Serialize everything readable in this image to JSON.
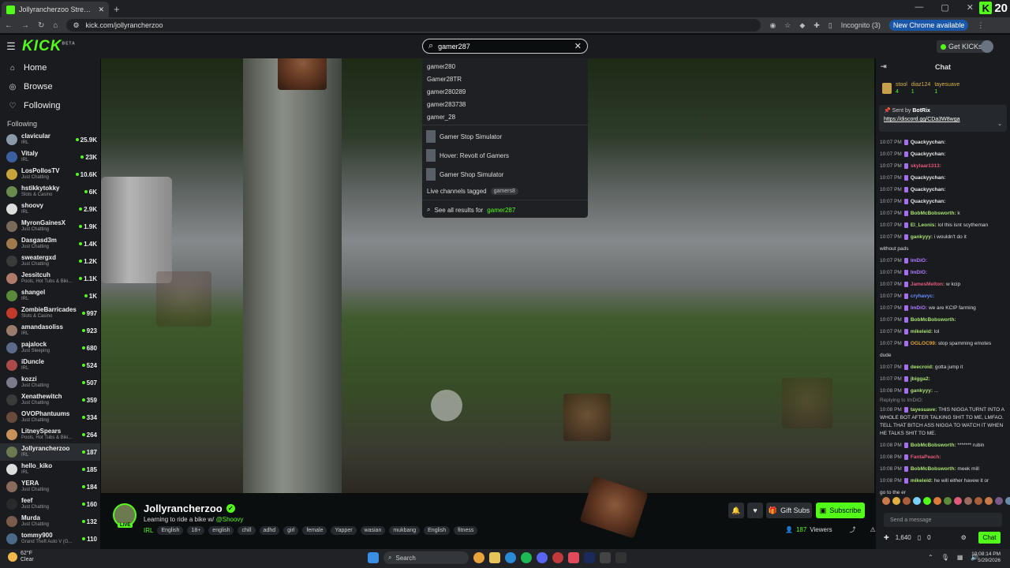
{
  "browser": {
    "tab_title": "Jollyrancherzoo Stream - Watc",
    "new_tab": "+",
    "url": "kick.com/jollyrancherzoo",
    "incognito": "Incognito (3)",
    "new_chrome": "New Chrome available"
  },
  "corner": {
    "logo": "K",
    "num": "20"
  },
  "header": {
    "logo": "KICK",
    "beta": "BETA",
    "search_value": "gamer287",
    "get_kicks": "Get KICKs"
  },
  "nav": [
    {
      "label": "Home",
      "icon": "home-icon"
    },
    {
      "label": "Browse",
      "icon": "compass-icon"
    },
    {
      "label": "Following",
      "icon": "heart-icon"
    }
  ],
  "following_title": "Following",
  "channels": [
    {
      "name": "clavicular",
      "cat": "IRL",
      "viewers": "25.9K",
      "color": "#8a9aa8"
    },
    {
      "name": "Vitaly",
      "cat": "IRL",
      "viewers": "23K",
      "color": "#3b5fa0"
    },
    {
      "name": "LosPollosTV",
      "cat": "Just Chatting",
      "viewers": "10.6K",
      "color": "#c8a23a"
    },
    {
      "name": "hstikkytokky",
      "cat": "Slots & Casino",
      "viewers": "6K",
      "color": "#6b8a4e"
    },
    {
      "name": "shoovy",
      "cat": "IRL",
      "viewers": "2.9K",
      "color": "#ddd"
    },
    {
      "name": "MyronGainesX",
      "cat": "Just Chatting",
      "viewers": "1.9K",
      "color": "#7a6a5a"
    },
    {
      "name": "Dasgasd3m",
      "cat": "Just Chatting",
      "viewers": "1.4K",
      "color": "#a0784e"
    },
    {
      "name": "sweatergxd",
      "cat": "Just Chatting",
      "viewers": "1.2K",
      "color": "#3a3a3a"
    },
    {
      "name": "Jessitcuh",
      "cat": "Pools, Hot Tubs & Biki...",
      "viewers": "1.1K",
      "color": "#b07a6a"
    },
    {
      "name": "shangel",
      "cat": "IRL",
      "viewers": "1K",
      "color": "#5a8a3a"
    },
    {
      "name": "ZombieBarricades",
      "cat": "Slots & Casino",
      "viewers": "997",
      "color": "#c23a2a"
    },
    {
      "name": "amandasoliss",
      "cat": "IRL",
      "viewers": "923",
      "color": "#9a7a6a"
    },
    {
      "name": "pajalock",
      "cat": "Just Sleeping",
      "viewers": "680",
      "color": "#5a6a8a"
    },
    {
      "name": "iDuncle",
      "cat": "IRL",
      "viewers": "524",
      "color": "#aa4a4a"
    },
    {
      "name": "kozzi",
      "cat": "Just Chatting",
      "viewers": "507",
      "color": "#7a7a8a"
    },
    {
      "name": "Xenathewitch",
      "cat": "Just Chatting",
      "viewers": "359",
      "color": "#3a3a3a"
    },
    {
      "name": "OVOPhantuums",
      "cat": "Just Chatting",
      "viewers": "334",
      "color": "#6a4a3a"
    },
    {
      "name": "LitneySpears",
      "cat": "Pools, Hot Tubs & Biki...",
      "viewers": "264",
      "color": "#c8905a"
    },
    {
      "name": "Jollyrancherzoo",
      "cat": "IRL",
      "viewers": "187",
      "color": "#6c7a50"
    },
    {
      "name": "hello_kiko",
      "cat": "IRL",
      "viewers": "185",
      "color": "#ddd"
    },
    {
      "name": "YERA",
      "cat": "Just Chatting",
      "viewers": "184",
      "color": "#8a6a5a"
    },
    {
      "name": "feef",
      "cat": "Just Chatting",
      "viewers": "160",
      "color": "#2a2a2a"
    },
    {
      "name": "Murda",
      "cat": "Just Chatting",
      "viewers": "132",
      "color": "#7a5a4a"
    },
    {
      "name": "tommy900",
      "cat": "Grand Theft Auto V (G...",
      "viewers": "110",
      "color": "#4a6a8a"
    }
  ],
  "dropdown": {
    "suggestions": [
      "gamer280",
      "Gamer28TR",
      "gamer280289",
      "gamer283738",
      "gamer_28"
    ],
    "games": [
      {
        "pre": "Gamer",
        "rest": " Stop Simulator"
      },
      {
        "pre": "Hover: Revolt of ",
        "rest": "Gamers"
      },
      {
        "pre": "Gamer",
        "rest": " Shop Simulator"
      }
    ],
    "live_tagged": "Live channels tagged",
    "tag": "gamers8",
    "see_all": "See all results for",
    "see_all_q": "gamer287"
  },
  "stream": {
    "name": "Jollyrancherzoo",
    "title": "Learning to ride a bike w/",
    "mention": "@Shoovy",
    "live": "LIVE",
    "category": "IRL",
    "tags": [
      "English",
      "18+",
      "english",
      "chill",
      "adhd",
      "girl",
      "female",
      "Yapper",
      "wasian",
      "mukbang",
      "English",
      "fitness"
    ],
    "gift_subs": "Gift Subs",
    "subscribe": "Subscribe",
    "viewers": "187",
    "viewers_label": "Viewers"
  },
  "chat": {
    "title": "Chat",
    "gifters": [
      {
        "name": "stool",
        "count": "4"
      },
      {
        "name": "diaz124",
        "count": "1"
      },
      {
        "name": "tayesuave",
        "count": "1"
      }
    ],
    "pinned_by": "Sent by",
    "pinned_user": "BotRix",
    "pinned_link": "https://discord.gg/CDa3W8wga",
    "messages": [
      {
        "t": "10:07 PM",
        "u": "Quackyychan:",
        "m": "",
        "c": "#e9e9e9"
      },
      {
        "t": "10:07 PM",
        "u": "Quackyychan:",
        "m": "",
        "c": "#e9e9e9"
      },
      {
        "t": "10:07 PM",
        "u": "skylaar1313:",
        "m": "",
        "c": "#e05a7a"
      },
      {
        "t": "10:07 PM",
        "u": "Quackyychan:",
        "m": "",
        "c": "#e9e9e9"
      },
      {
        "t": "10:07 PM",
        "u": "Quackyychan:",
        "m": "",
        "c": "#e9e9e9"
      },
      {
        "t": "10:07 PM",
        "u": "Quackyychan:",
        "m": "",
        "c": "#e9e9e9"
      },
      {
        "t": "10:07 PM",
        "u": "BobMcBobsworth:",
        "m": " k",
        "c": "#a8e070"
      },
      {
        "t": "10:07 PM",
        "u": "El_Leonis:",
        "m": " lol this isnt scytheman",
        "c": "#a8e070"
      },
      {
        "t": "10:07 PM",
        "u": "gankyyy:",
        "m": " i wouldn't do it",
        "c": "#a8e070"
      },
      {
        "t": "",
        "u": "",
        "m": "without pads",
        "c": "#e9e9e9"
      },
      {
        "t": "10:07 PM",
        "u": "ImDiO:",
        "m": "",
        "c": "#b07aff"
      },
      {
        "t": "10:07 PM",
        "u": "ImDiO:",
        "m": "",
        "c": "#b07aff"
      },
      {
        "t": "10:07 PM",
        "u": "JamesMelton:",
        "m": " w kcip",
        "c": "#e05a7a"
      },
      {
        "t": "10:07 PM",
        "u": "cryhavyc:",
        "m": "",
        "c": "#6a8aff"
      },
      {
        "t": "10:07 PM",
        "u": "ImDiO:",
        "m": " we are KCIP farming",
        "c": "#b07aff"
      },
      {
        "t": "10:07 PM",
        "u": "BobMcBobsworth:",
        "m": "",
        "c": "#a8e070"
      },
      {
        "t": "10:07 PM",
        "u": "mikeleid:",
        "m": " lol",
        "c": "#a8e070"
      },
      {
        "t": "10:07 PM",
        "u": "OGLOC99:",
        "m": " stop spamming emotes",
        "c": "#e0a040"
      },
      {
        "t": "",
        "u": "",
        "m": "dude",
        "c": "#e9e9e9"
      },
      {
        "t": "10:07 PM",
        "u": "deecroid:",
        "m": " gotta jump it",
        "c": "#a8e070"
      },
      {
        "t": "10:07 PM",
        "u": "jbigga2:",
        "m": "",
        "c": "#a8e070"
      },
      {
        "t": "10:08 PM",
        "u": "gankyyy:",
        "m": " ...",
        "c": "#a8e070"
      }
    ],
    "reply_to": "Replying to ImDiO:",
    "long_msg": {
      "t": "10:08 PM",
      "u": "tayesuave:",
      "m": " THIS NIGGA TURNT INTO A WHOLE BOT AFTER TALKING SHIT TO ME, LMFAO. TELL THAT BITCH ASS NIGGA TO WATCH IT WHEN HE TALKS SHIT TO ME."
    },
    "messages2": [
      {
        "t": "10:08 PM",
        "u": "BobMcBobsworth:",
        "m": " ******* rubin",
        "c": "#a8e070"
      },
      {
        "t": "10:08 PM",
        "u": "FantaPeach:",
        "m": "",
        "c": "#e05a7a"
      },
      {
        "t": "10:08 PM",
        "u": "BobMcBobsworth:",
        "m": " meek mill",
        "c": "#a8e070"
      },
      {
        "t": "10:08 PM",
        "u": "mikeleid:",
        "m": " he will either havew it or",
        "c": "#a8e070"
      },
      {
        "t": "",
        "u": "",
        "m": "go to the er",
        "c": "#e9e9e9"
      }
    ],
    "input_placeholder": "Send a message",
    "points": "1,640",
    "zero": "0",
    "send": "Chat"
  },
  "taskbar": {
    "temp": "62°F",
    "cond": "Clear",
    "search": "Search",
    "time": "10:08:14 PM",
    "date": "5/29/2026"
  }
}
